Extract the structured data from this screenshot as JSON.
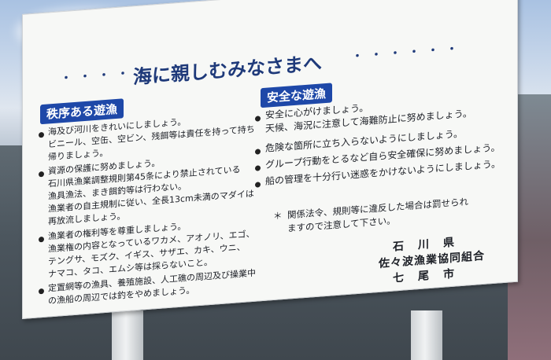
{
  "sign": {
    "title": "海に親しむみなさまへ",
    "left_dots": "・・・・・",
    "right_dots": "・・・・・・",
    "left_section": {
      "title": "秩序ある遊漁",
      "items": [
        {
          "lines": [
            "海及び河川をきれいにしましょう。",
            "ビニール、空缶、空ビン、残餌等は責任を持って持ち",
            "帰りましょう。"
          ]
        },
        {
          "lines": [
            "資源の保護に努めましょう。",
            "石川県漁業調整規則第45条により禁止されている",
            "漁具漁法、まき餌釣等は行わない。",
            "漁業者の自主規制に従い、全長13cm未満のマダイは",
            "再放流しましょう。"
          ]
        },
        {
          "lines": [
            "漁業者の権利等を尊重しましょう。",
            "漁業権の内容となっているワカメ、アオノリ、エゴ、",
            "テングサ、モズク、イギス、サザエ、カキ、ウニ、",
            "ナマコ、タコ、エムシ等は採らないこと。"
          ]
        },
        {
          "lines": [
            "定置網等の漁具、養殖施設、人工礁の周辺及び操業中",
            "の漁船の周辺では釣をやめましょう。"
          ]
        }
      ]
    },
    "right_section": {
      "title": "安全な遊漁",
      "items": [
        {
          "lines": [
            "安全に心がけましょう。",
            "天候、海況に注意して海難防止に努めましょう。"
          ]
        },
        {
          "lines": [
            "危険な箇所に立ち入らないようにしましょう。"
          ]
        },
        {
          "lines": [
            "グループ行動をとるなど自ら安全確保に努めましょう。"
          ]
        },
        {
          "lines": [
            "船の管理を十分行い迷惑をかけないようにしましょう。"
          ]
        }
      ],
      "note_mark": "＊",
      "note_lines": [
        "関係法令、規則等に違反した場合は罰せられ",
        "ますので注意して下さい。"
      ]
    },
    "signatories": [
      "石　川　県",
      "佐々波漁業協同組合",
      "七　尾　市"
    ]
  },
  "colors": {
    "accent": "#1e48a8",
    "title": "#1f3a7a",
    "board": "#f7f8f6"
  }
}
